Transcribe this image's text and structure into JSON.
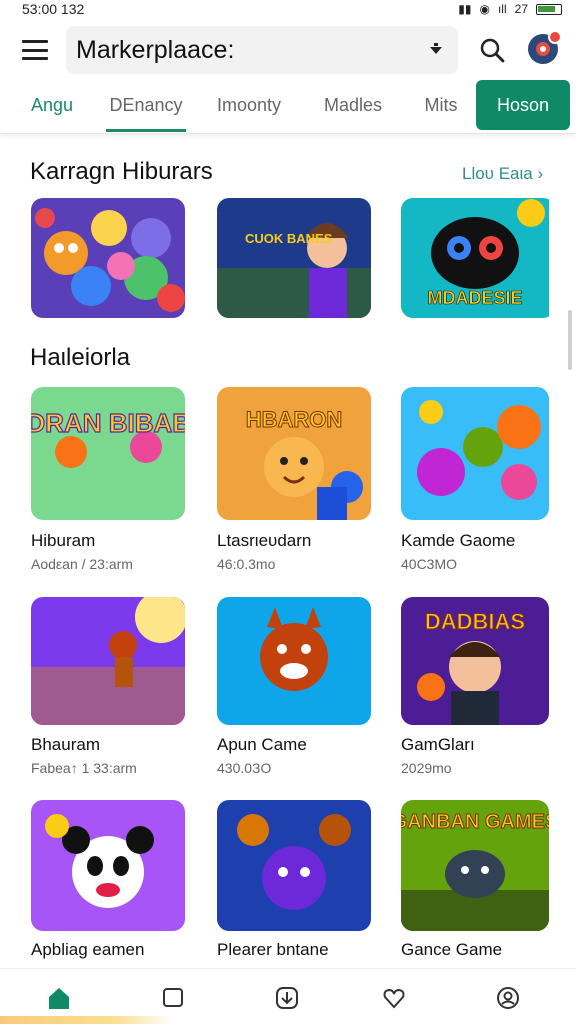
{
  "status_bar": {
    "time": "53:00 132",
    "battery": "27"
  },
  "app_bar": {
    "search_value": "Markerplaace:"
  },
  "tabs": [
    {
      "label": "Angu"
    },
    {
      "label": "DEnancy"
    },
    {
      "label": "Imoonty"
    },
    {
      "label": "Madles"
    },
    {
      "label": "Mits"
    },
    {
      "label": "Hoson"
    }
  ],
  "sections": {
    "featured": {
      "title": "Karragn Hiburars",
      "see_all": "Lloυ Eaιa ›"
    },
    "grid": {
      "title": "Haιleiorla"
    }
  },
  "cards_top": [
    {
      "art": "blobs"
    },
    {
      "art": "boy",
      "text": "CUOK BANES"
    },
    {
      "art": "mask",
      "text": "MDADESIE"
    }
  ],
  "grid_items": [
    {
      "art": "logo",
      "text": "NDRAN BIBABS",
      "title": "Hiburam",
      "subtitle": "Aodεan / 23:arm"
    },
    {
      "art": "bear",
      "text": "HBARON",
      "title": "Ltasrιeυdarn",
      "subtitle": "46:0.3mo"
    },
    {
      "art": "blobs",
      "title": "Kamde Gaome",
      "subtitle": "40C3MO"
    },
    {
      "art": "runner",
      "title": "Bhauram",
      "subtitle": "Fabea↑ 1 33:arm"
    },
    {
      "art": "wolf",
      "title": "Apun Came",
      "subtitle": "430.0ЗO"
    },
    {
      "art": "kid",
      "text": "DADBIAS",
      "title": "GamGları",
      "subtitle": "2029mo"
    },
    {
      "art": "panda",
      "title": "Apbliag eamen",
      "subtitle": ""
    },
    {
      "art": "cats",
      "title": "Plearer bntane",
      "subtitle": ""
    },
    {
      "art": "cow",
      "text": "GANBAN GAMES",
      "title": "Gance Game",
      "subtitle": ""
    }
  ],
  "bottom_nav": [
    {
      "icon": "home-icon"
    },
    {
      "icon": "chat-icon"
    },
    {
      "icon": "download-icon"
    },
    {
      "icon": "heart-icon"
    },
    {
      "icon": "profile-icon"
    }
  ],
  "colors": {
    "accent": "#0e8a66",
    "tab_active": "#1a8a69",
    "link": "#2f8f8a"
  }
}
